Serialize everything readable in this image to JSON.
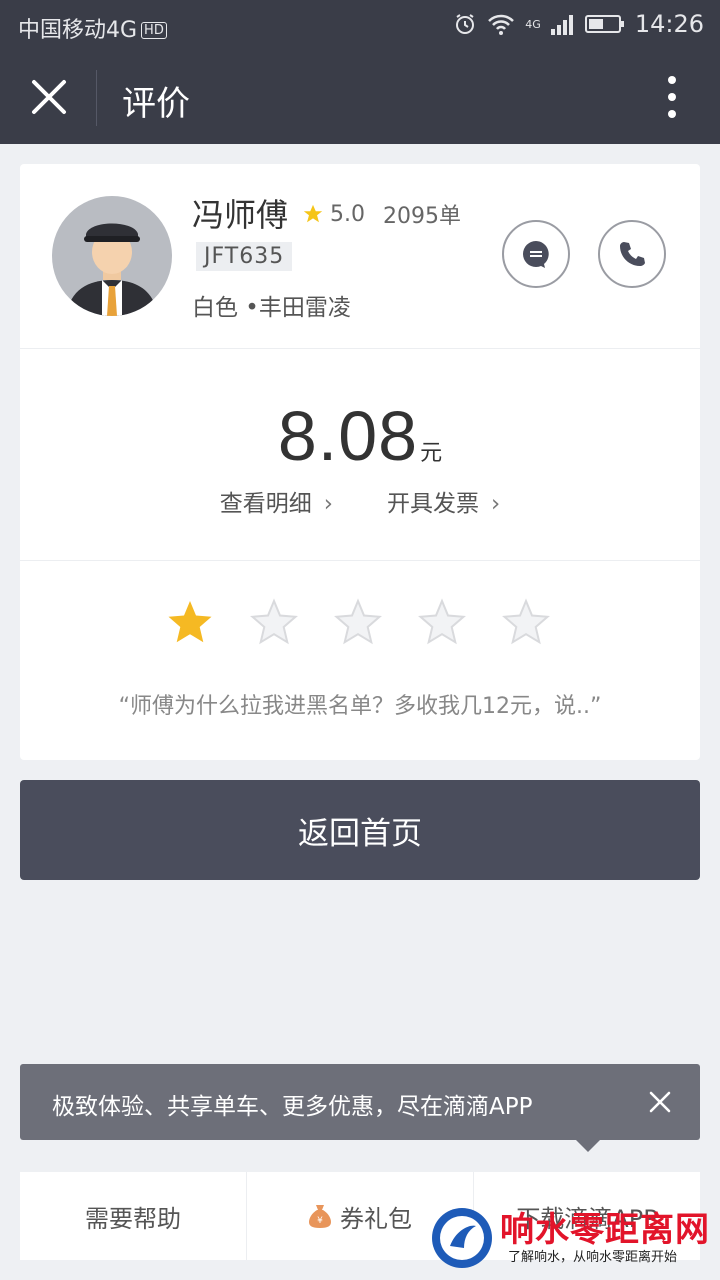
{
  "status_bar": {
    "carrier": "中国移动4G",
    "hd": "HD",
    "network": "4G",
    "time": "14:26"
  },
  "header": {
    "title": "评价"
  },
  "driver": {
    "name": "冯师傅",
    "rating": "5.0",
    "orders": "2095单",
    "plate": "JFT635",
    "car": "白色 •丰田雷凌"
  },
  "fare": {
    "amount": "8.08",
    "unit": "元",
    "detail_link": "查看明细",
    "invoice_link": "开具发票",
    "chevron": "›"
  },
  "review": {
    "stars_total": 5,
    "stars_selected": 1,
    "comment": "“师傅为什么拉我进黑名单？多收我几12元，说..”"
  },
  "home_button": "返回首页",
  "promo": {
    "text": "极致体验、共享单车、更多优惠，尽在滴滴APP"
  },
  "bottom_bar": {
    "help": "需要帮助",
    "coupon": "券礼包",
    "download": "下载滴滴APP"
  },
  "watermark": {
    "title": "响水零距离网",
    "subtitle": "了解响水，从响水零距离开始"
  },
  "colors": {
    "header_bg": "#3a3d48",
    "star_active": "#f5b923",
    "star_inactive": "#d9dadd",
    "button_bg": "#4a4d5c"
  }
}
